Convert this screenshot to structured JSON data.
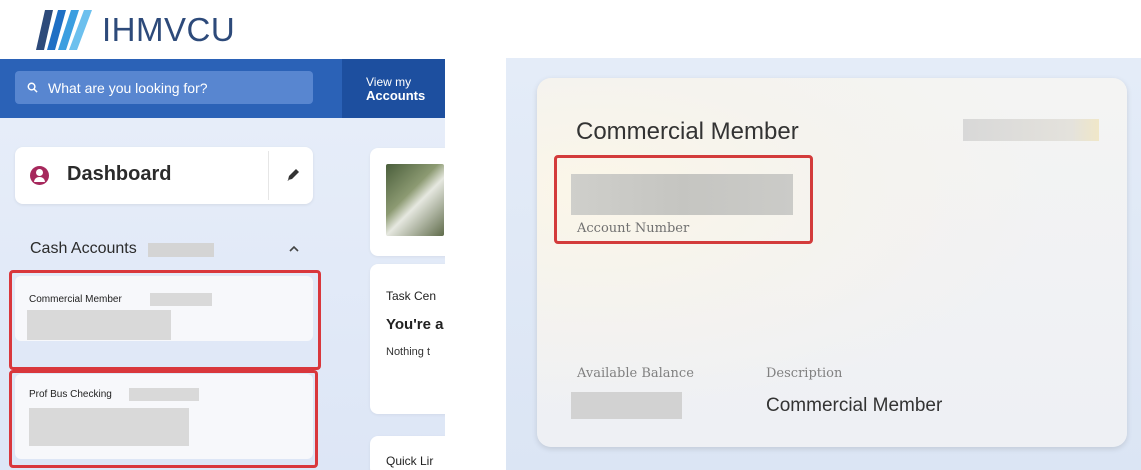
{
  "brand": {
    "name": "IHMVCU"
  },
  "search": {
    "placeholder": "What are you looking for?"
  },
  "nav": {
    "accounts_line1": "View my",
    "accounts_line2": "Accounts"
  },
  "dashboard": {
    "label": "Dashboard"
  },
  "cash_accounts": {
    "title": "Cash Accounts",
    "items": [
      {
        "name": "Commercial Member"
      },
      {
        "name": "Prof Bus Checking"
      }
    ]
  },
  "middle": {
    "task_center": "Task Cen",
    "task_heading": "You're a",
    "task_sub": "Nothing t",
    "quick_links": "Quick Lir"
  },
  "detail_card": {
    "title": "Commercial Member",
    "account_number_label": "Account Number",
    "available_balance_label": "Available Balance",
    "description_label": "Description",
    "description_value": "Commercial Member"
  },
  "colors": {
    "brand_blue": "#2b62b7",
    "accounts_tab": "#1d4f9f",
    "dashboard_icon": "#a6285c",
    "highlight_red": "#d9373c"
  },
  "icons": [
    "logo-mark",
    "search-icon",
    "user-icon",
    "pencil-icon",
    "chevron-up-icon"
  ]
}
